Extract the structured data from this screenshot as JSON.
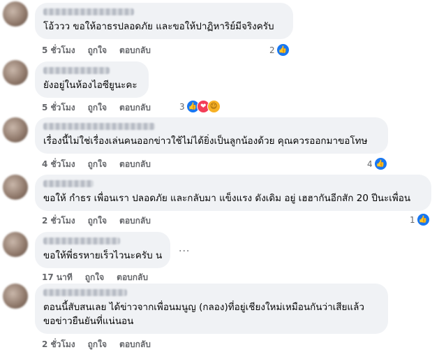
{
  "comments": [
    {
      "text_lines": [
        "โอ้ววว ขอให้อาธรปลอดภัย และขอให้ปาฏิหาริย์มีจริงครับ"
      ],
      "time": "5 ชั่วโมง",
      "like": "ถูกใจ",
      "reply": "ตอบกลับ",
      "reaction_count": "2",
      "reaction_icons": [
        "like-icon"
      ]
    },
    {
      "text_lines": [
        "ยังอยู่ในห้องไอซียูนะคะ"
      ],
      "time": "5 ชั่วโมง",
      "like": "ถูกใจ",
      "reply": "ตอบกลับ",
      "reaction_count": "3",
      "reaction_icons": [
        "like-icon",
        "love-icon",
        "care-icon"
      ]
    },
    {
      "text_lines": [
        "เรื่องนี้ไม่ใช่เรื่องเล่นคนออกข่าวใช้ไม่ได้ยิ่งเป็นลูกน้องด้วย คุณควรออกมาขอโทษ"
      ],
      "time": "4 ชั่วโมง",
      "like": "ถูกใจ",
      "reply": "ตอบกลับ",
      "reaction_count": "4",
      "reaction_icons": [
        "like-icon"
      ]
    },
    {
      "text_lines": [
        "ขอให้ กำธร เพื่อนเรา ปลอดภัย และกลับมา แข็งแรง ดังเดิม อยู่ เฮฮากันอีกสัก 20 ปีนะเพื่อน"
      ],
      "time": "2 ชั่วโมง",
      "like": "ถูกใจ",
      "reply": "ตอบกลับ",
      "reaction_count": "1",
      "reaction_icons": [
        "like-icon"
      ]
    },
    {
      "text_lines": [
        "ขอให้พี่ธรหายเร็วไวนะครับ น"
      ],
      "time": "17 นาที",
      "like": "ถูกใจ",
      "reply": "ตอบกลับ",
      "more": "..."
    },
    {
      "text_lines": [
        "ตอนนี้สับสนเลย ได้ข่าวจากเพื่อนมนูญ (กลอง)ที่อยู่เชียงใหม่เหมือนกันว่าเสียแล้ว",
        "ขอข่าวยืนยันที่แน่นอน"
      ],
      "time": "2 ชั่วโมง",
      "like": "ถูกใจ",
      "reply": "ตอบกลับ"
    }
  ],
  "colors": {
    "bubble": "#f0f2f5",
    "meta": "#65676b",
    "like": "#1877f2",
    "love": "#f33e58",
    "care": "#f7b125"
  }
}
